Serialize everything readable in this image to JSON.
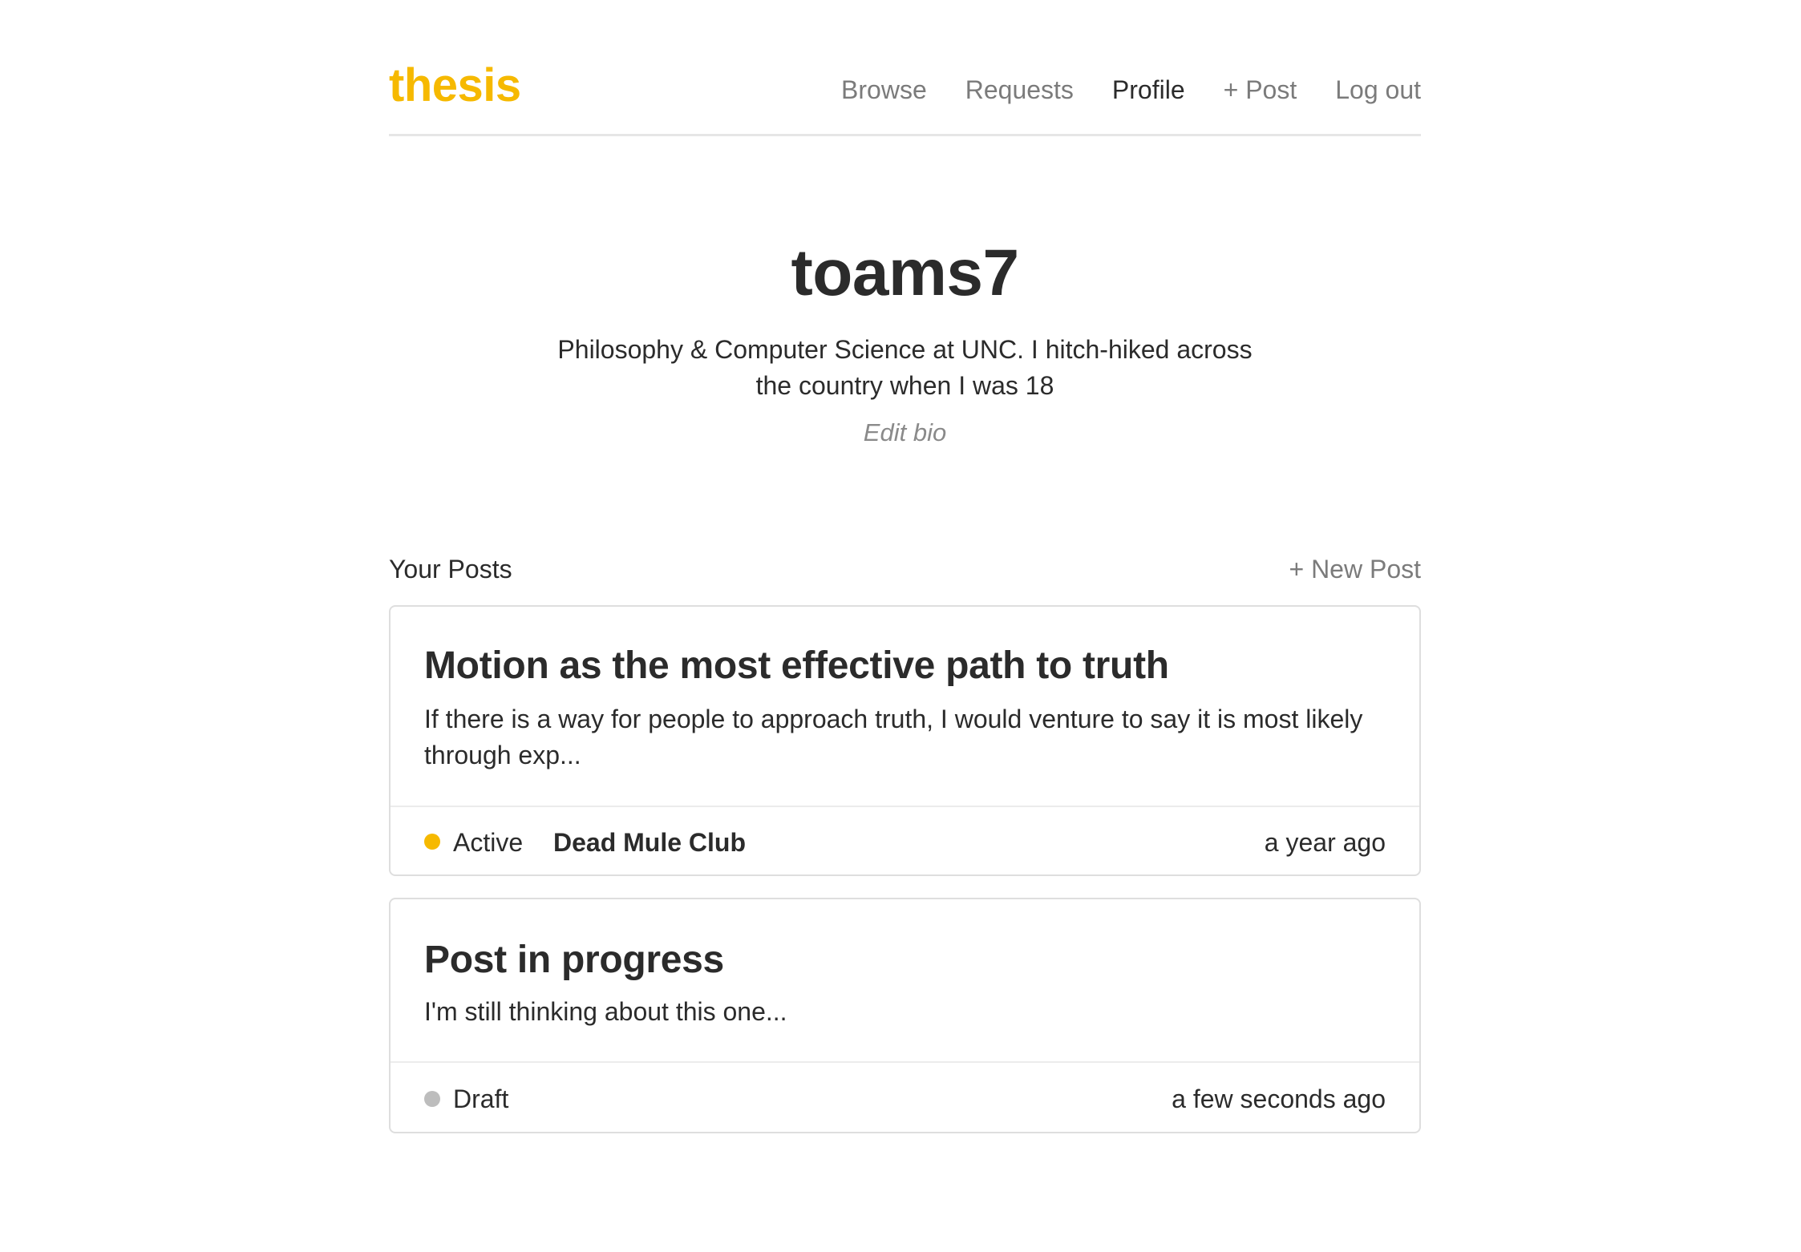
{
  "header": {
    "logo": "thesis",
    "nav": [
      {
        "label": "Browse"
      },
      {
        "label": "Requests"
      },
      {
        "label": "Profile"
      },
      {
        "label": "+ Post"
      },
      {
        "label": "Log out"
      }
    ]
  },
  "profile": {
    "username": "toams7",
    "bio": "Philosophy & Computer Science at UNC. I hitch-hiked across the country when I was 18",
    "edit_bio": "Edit bio"
  },
  "posts": {
    "title": "Your Posts",
    "new_post": "+ New Post",
    "items": [
      {
        "title": "Motion as the most effective path to truth",
        "excerpt": "If there is a way for people to approach truth, I would venture to say it is most likely through exp...",
        "status": "Active",
        "status_color": "#f6b900",
        "group": "Dead Mule Club",
        "time": "a year ago"
      },
      {
        "title": "Post in progress",
        "excerpt": "I'm still thinking about this one...",
        "status": "Draft",
        "status_color": "#bdbdbd",
        "time": "a few seconds ago"
      }
    ]
  },
  "colors": {
    "accent": "#f6b900",
    "text": "#2b2b2b",
    "muted": "#7b7b7b"
  }
}
